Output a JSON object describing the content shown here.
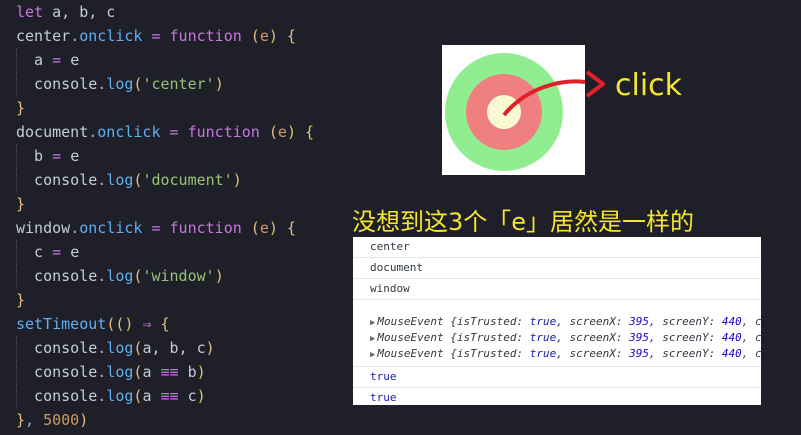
{
  "code": {
    "lines": [
      {
        "parts": [
          [
            "kw",
            "let"
          ],
          [
            "obj",
            " a, b, c"
          ]
        ]
      },
      {
        "parts": [
          [
            "obj",
            "center"
          ],
          [
            "dim",
            "."
          ],
          [
            "prop",
            "onclick"
          ],
          [
            "op",
            " = "
          ],
          [
            "kw",
            "function"
          ],
          [
            "paren",
            " ("
          ],
          [
            "param",
            "e"
          ],
          [
            "paren",
            ")"
          ],
          [
            "brace",
            " {"
          ]
        ]
      },
      {
        "parts": [
          [
            "obj",
            "  a"
          ],
          [
            "op",
            " = "
          ],
          [
            "obj",
            "e"
          ]
        ]
      },
      {
        "parts": [
          [
            "obj",
            "  console"
          ],
          [
            "dim",
            "."
          ],
          [
            "fn",
            "log"
          ],
          [
            "paren",
            "("
          ],
          [
            "str",
            "'center'"
          ],
          [
            "paren",
            ")"
          ]
        ]
      },
      {
        "parts": [
          [
            "brace",
            "}"
          ]
        ]
      },
      {
        "parts": [
          [
            "obj",
            "document"
          ],
          [
            "dim",
            "."
          ],
          [
            "prop",
            "onclick"
          ],
          [
            "op",
            " = "
          ],
          [
            "kw",
            "function"
          ],
          [
            "paren",
            " ("
          ],
          [
            "param",
            "e"
          ],
          [
            "paren",
            ")"
          ],
          [
            "brace",
            " {"
          ]
        ]
      },
      {
        "parts": [
          [
            "obj",
            "  b"
          ],
          [
            "op",
            " = "
          ],
          [
            "obj",
            "e"
          ]
        ]
      },
      {
        "parts": [
          [
            "obj",
            "  console"
          ],
          [
            "dim",
            "."
          ],
          [
            "fn",
            "log"
          ],
          [
            "paren",
            "("
          ],
          [
            "str",
            "'document'"
          ],
          [
            "paren",
            ")"
          ]
        ]
      },
      {
        "parts": [
          [
            "brace",
            "}"
          ]
        ]
      },
      {
        "parts": [
          [
            "obj",
            "window"
          ],
          [
            "dim",
            "."
          ],
          [
            "prop",
            "onclick"
          ],
          [
            "op",
            " = "
          ],
          [
            "kw",
            "function"
          ],
          [
            "paren",
            " ("
          ],
          [
            "param",
            "e"
          ],
          [
            "paren",
            ")"
          ],
          [
            "brace",
            " {"
          ]
        ]
      },
      {
        "parts": [
          [
            "obj",
            "  c"
          ],
          [
            "op",
            " = "
          ],
          [
            "obj",
            "e"
          ]
        ]
      },
      {
        "parts": [
          [
            "obj",
            "  console"
          ],
          [
            "dim",
            "."
          ],
          [
            "fn",
            "log"
          ],
          [
            "paren",
            "("
          ],
          [
            "str",
            "'window'"
          ],
          [
            "paren",
            ")"
          ]
        ]
      },
      {
        "parts": [
          [
            "brace",
            "}"
          ]
        ]
      },
      {
        "parts": [
          [
            "fn",
            "setTimeout"
          ],
          [
            "paren",
            "(() "
          ],
          [
            "op",
            "⇒"
          ],
          [
            "brace",
            " {"
          ]
        ]
      },
      {
        "parts": [
          [
            "obj",
            "  console"
          ],
          [
            "dim",
            "."
          ],
          [
            "fn",
            "log"
          ],
          [
            "paren",
            "("
          ],
          [
            "obj",
            "a, b, c"
          ],
          [
            "paren",
            ")"
          ]
        ]
      },
      {
        "parts": [
          [
            "obj",
            "  console"
          ],
          [
            "dim",
            "."
          ],
          [
            "fn",
            "log"
          ],
          [
            "paren",
            "("
          ],
          [
            "obj",
            "a "
          ],
          [
            "op",
            "≡≡"
          ],
          [
            "obj",
            " b"
          ],
          [
            "paren",
            ")"
          ]
        ]
      },
      {
        "parts": [
          [
            "obj",
            "  console"
          ],
          [
            "dim",
            "."
          ],
          [
            "fn",
            "log"
          ],
          [
            "paren",
            "("
          ],
          [
            "obj",
            "a "
          ],
          [
            "op",
            "≡≡"
          ],
          [
            "obj",
            " c"
          ],
          [
            "paren",
            ")"
          ]
        ]
      },
      {
        "parts": [
          [
            "brace",
            "}"
          ],
          [
            "dim",
            ", "
          ],
          [
            "num",
            "5000"
          ],
          [
            "paren",
            ")"
          ]
        ]
      }
    ]
  },
  "annotation": {
    "click_label": "click",
    "caption": "没想到这3个「e」居然是一样的"
  },
  "target_colors": {
    "outer": "#90ee90",
    "middle": "#f08080",
    "inner": "#fafad2",
    "arrow": "#e0202a"
  },
  "console": {
    "logs": [
      "center",
      "document",
      "window"
    ],
    "events": [
      {
        "label": "MouseEvent",
        "isTrusted": "true",
        "screenX": "395",
        "screenY": "440"
      },
      {
        "label": "MouseEvent",
        "isTrusted": "true",
        "screenX": "395",
        "screenY": "440"
      },
      {
        "label": "MouseEvent",
        "isTrusted": "true",
        "screenX": "395",
        "screenY": "440"
      }
    ],
    "results": [
      "true",
      "true"
    ]
  }
}
